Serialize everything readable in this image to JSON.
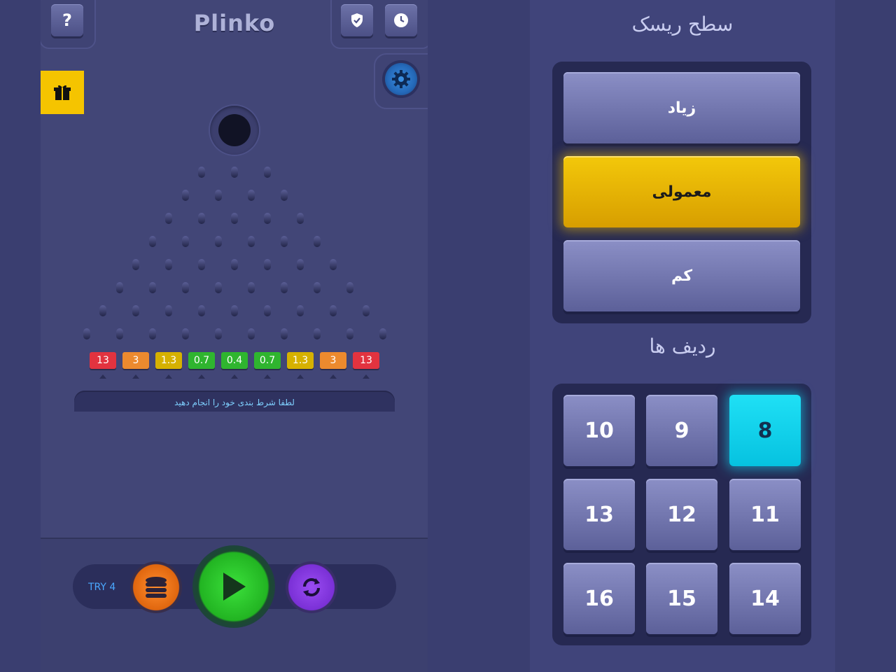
{
  "game": {
    "logo": "Plinko",
    "help_label": "?",
    "multipliers": [
      {
        "value": "13",
        "color": "#e2333f"
      },
      {
        "value": "3",
        "color": "#ec8a2e"
      },
      {
        "value": "1.3",
        "color": "#d6b100"
      },
      {
        "value": "0.7",
        "color": "#2fb52f"
      },
      {
        "value": "0.4",
        "color": "#2fb52f"
      },
      {
        "value": "0.7",
        "color": "#2fb52f"
      },
      {
        "value": "1.3",
        "color": "#d6b100"
      },
      {
        "value": "3",
        "color": "#ec8a2e"
      },
      {
        "value": "13",
        "color": "#e2333f"
      }
    ],
    "message": "لطفا شرط بندی خود را انجام دهید",
    "try_label": "TRY 4"
  },
  "settings": {
    "risk_title": "سطح ریسک",
    "risk_options": [
      {
        "label": "زیاد",
        "selected": false
      },
      {
        "label": "معمولی",
        "selected": true
      },
      {
        "label": "کم",
        "selected": false
      }
    ],
    "rows_title": "ردیف ها",
    "row_options": [
      {
        "label": "10",
        "selected": false
      },
      {
        "label": "9",
        "selected": false
      },
      {
        "label": "8",
        "selected": true
      },
      {
        "label": "13",
        "selected": false
      },
      {
        "label": "12",
        "selected": false
      },
      {
        "label": "11",
        "selected": false
      },
      {
        "label": "16",
        "selected": false
      },
      {
        "label": "15",
        "selected": false
      },
      {
        "label": "14",
        "selected": false
      }
    ]
  },
  "colors": {
    "accent_yellow": "#f5c400",
    "accent_cyan": "#14d2f0",
    "play_green": "#22b422",
    "coin_orange": "#e0660e",
    "refresh_purple": "#7a30d6"
  }
}
